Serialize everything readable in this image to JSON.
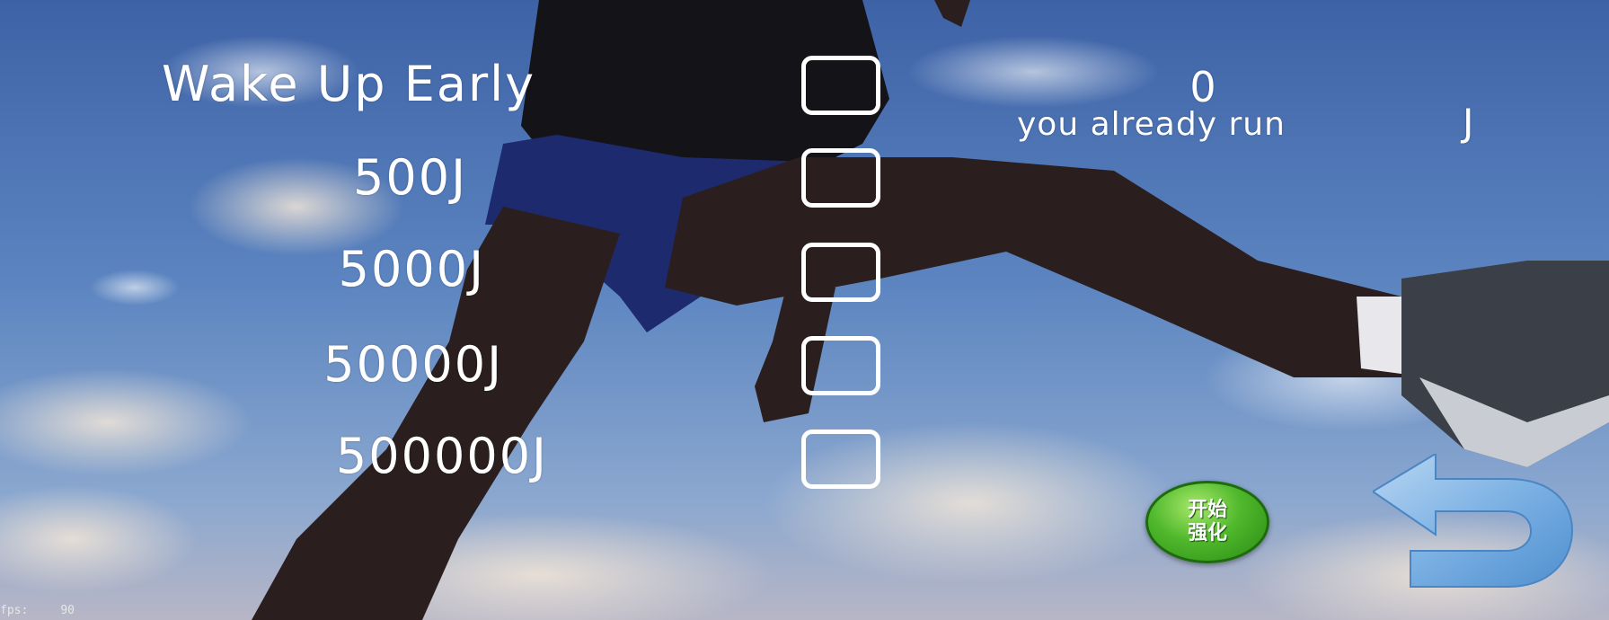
{
  "goals": {
    "title": "Wake Up Early",
    "items": [
      {
        "label": "500J",
        "checked": false
      },
      {
        "label": "5000J",
        "checked": false
      },
      {
        "label": "50000J",
        "checked": false
      },
      {
        "label": "500000J",
        "checked": false
      }
    ],
    "title_checked": false
  },
  "stats": {
    "counter_value": "0",
    "already_run_label": "you already run",
    "unit": "J"
  },
  "start_button": {
    "label": "开始强化",
    "color": "#4fb82c"
  },
  "back_button": {
    "icon": "back-arrow-icon",
    "color": "#6ea7dc"
  },
  "fps": {
    "label": "fps:",
    "value": "90"
  }
}
